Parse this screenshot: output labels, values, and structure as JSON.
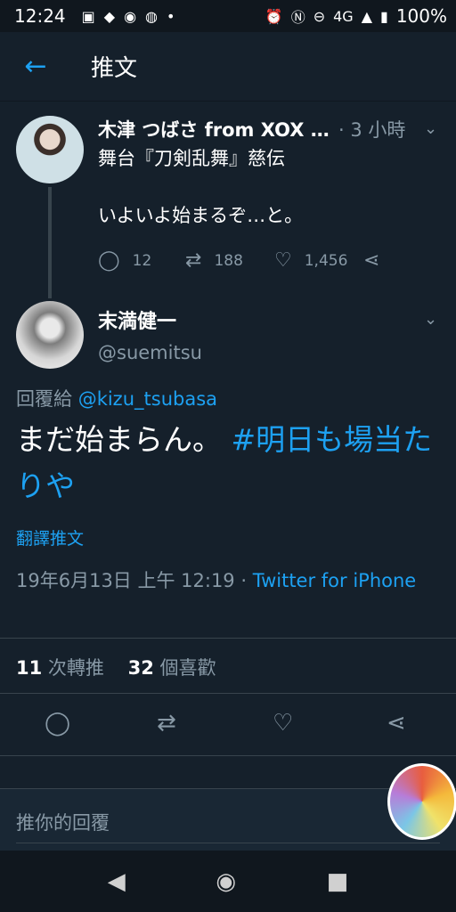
{
  "status_bar": {
    "time": "12:24",
    "network": "4G",
    "battery": "100%",
    "icons": [
      "image-icon",
      "app-icon",
      "line-icon",
      "app-icon-2",
      "dot-icon",
      "alarm-icon",
      "nfc-icon",
      "dnd-icon",
      "signal-icon",
      "battery-icon"
    ]
  },
  "header": {
    "title": "推文"
  },
  "parent_tweet": {
    "name": "木津 つばさ from XOX ...",
    "meta": "· 3 小時",
    "text": "舞台『刀剣乱舞』慈伝\n\nいよいよ始まるぞ…と。",
    "replies": "12",
    "retweets": "188",
    "likes": "1,456"
  },
  "tweet": {
    "name": "末満健一",
    "handle": "@suemitsu",
    "reply_label": "回覆給",
    "reply_mention": "@kizu_tsubasa",
    "text": "まだ始まらん。",
    "hashtag": "#明日も場当たりや",
    "translate_label": "翻譯推文",
    "timestamp": "19年6月13日 上午 12:19 ·",
    "source": "Twitter for iPhone"
  },
  "stats": {
    "retweets_count": "11",
    "retweets_label": "次轉推",
    "likes_count": "32",
    "likes_label": "個喜歡"
  },
  "reply_box": {
    "placeholder": "推你的回覆"
  },
  "colors": {
    "background": "#15202b",
    "accent": "#1da1f2",
    "secondary_text": "#8899a6",
    "divider": "#38444d"
  }
}
